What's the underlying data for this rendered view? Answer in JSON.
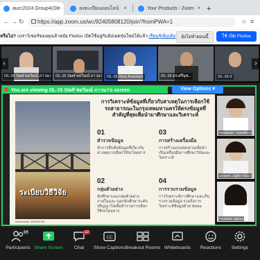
{
  "browser": {
    "tabs": [
      {
        "title": "aucc2024 Group4(OL-13 to OL",
        "fav_color": "#2d8cff",
        "active": true
      },
      {
        "title": "ลงทะเบียนออนไลน์",
        "fav_color": "#2d8cff",
        "active": false
      },
      {
        "title": "Your Products - Zoom",
        "fav_color": "#2d8cff",
        "active": false
      }
    ],
    "url": "https://app.zoom.us/wc/92405808120/join?fromPWA=1"
  },
  "notice": {
    "prefix": "หรือไม่?",
    "text": " เบราว์เซอร์ของคุณล้าสมัย Firefox เปิดใช้อยู่กับอัปเดตรุ่นใหม่ได้แล้ว ",
    "link": "เรียนรู้เพิ่มเติม",
    "later_label": "ยังไม่ทำตอนนี้",
    "firefox_label": "ใช้ เปิด Firefox"
  },
  "participants_strip": [
    {
      "label": "OL-15 Staff พลวิมณ์ ภาวนา...",
      "bg": "#3a3f45"
    },
    {
      "label": "OL-15 Staff พลวิมณ์ ภาวนา...",
      "bg": "#5d6470"
    },
    {
      "label": "OL-15 Host Assistant",
      "bg": "#1e3b78"
    },
    {
      "label": "OL-15 ดร.ศรีนุช...",
      "bg": "#6a6f76"
    },
    {
      "label": "OL-15-0",
      "bg": "#444a52"
    }
  ],
  "share_banner": {
    "text": "You are viewing  OL-15 Staff พลวิมณ์ ภาวนา's screen",
    "view_options": "View Options ▾"
  },
  "slide": {
    "title": "การวิเคราะห์ข้อมูลที่เกี่ยวกับสาเหตุในการเลือกใช้รถสาธารณะในกรุงเทพมหานครให้ตรงข้อมูลที่สำคัญที่สุดเพื่อนำมาศึกษาและวิเคราะห์",
    "image_caption": "ระเบียบวิธีวิจัย",
    "image_small": "Researcher: BANGKOK",
    "steps": [
      {
        "num": "01",
        "title": "สำรวจข้อมูล",
        "desc": "ทำการสืบค้นข้อมูลที่เกี่ยวกับสาเหตุการเลือกใช้รถโดยสาร"
      },
      {
        "num": "02",
        "title": "กลุ่มตัวอย่าง",
        "desc": "นักศึกษาและกลุ่มตัวอย่าง ภายในและ นอกนักศึกษาระดับปริญญาโทเพื่อสำรวจการเลือกใช้รถโดยสาร"
      },
      {
        "num": "03",
        "title": "การสร้างเครื่องมือ",
        "desc": "การสร้างแบบสอบถามเพื่อนำเป็นเครื่องมือการศึกษาวิจัยและวิเคราะห์"
      },
      {
        "num": "04",
        "title": "การรวบรวมข้อมูล",
        "desc": "การวิเคราะห์การศึกษาและเก็บรวบรวมข้อมูล รวมถึงการวิเคราะห์ข้อมูลด้วย Weka"
      }
    ]
  },
  "side_cams": [
    {
      "label": "PanuphatK...ธนพงศ์ปาน",
      "bg": "#cfcfcf"
    },
    {
      "label": "Jarawee...ณัฐธิดา ฉิมมา",
      "bg": "#d8d3cc"
    },
    {
      "label": "Purimwat...พุฒิเมธ",
      "bg": "#e9e9e9"
    }
  ],
  "toolbar": {
    "items": [
      {
        "label": "Participants",
        "badge": "14"
      },
      {
        "label": "Share Screen",
        "badge": ""
      },
      {
        "label": "Chat",
        "badge": "12"
      },
      {
        "label": "Show Captions",
        "badge": ""
      },
      {
        "label": "Breakout Rooms",
        "badge": ""
      },
      {
        "label": "Whiteboards",
        "badge": ""
      },
      {
        "label": "Reactions",
        "badge": ""
      },
      {
        "label": "Settings",
        "badge": ""
      }
    ]
  }
}
